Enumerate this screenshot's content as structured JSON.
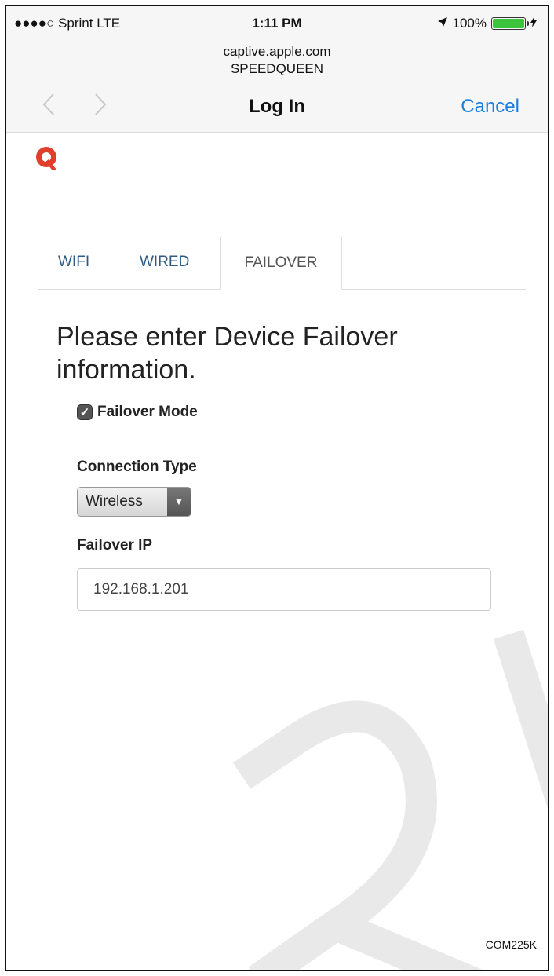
{
  "status_bar": {
    "carrier": "●●●●○ Sprint  LTE",
    "time": "1:11 PM",
    "location_icon": "location-arrow-icon",
    "battery": "100%",
    "battery_level": 1.0,
    "charging_icon": "lightning-icon"
  },
  "browser": {
    "host": "captive.apple.com",
    "network": "SPEEDQUEEN",
    "back_icon": "chevron-left-icon",
    "forward_icon": "chevron-right-icon",
    "title": "Log In",
    "cancel_label": "Cancel"
  },
  "logo": {
    "icon": "speedqueen-logo-icon"
  },
  "tabs": [
    {
      "label": "WIFI",
      "active": false
    },
    {
      "label": "WIRED",
      "active": false
    },
    {
      "label": "FAILOVER",
      "active": true
    }
  ],
  "form": {
    "heading": "Please enter Device Failover information.",
    "failover_mode_label": "Failover Mode",
    "failover_mode_checked": true,
    "connection_type_label": "Connection Type",
    "connection_type_value": "Wireless",
    "failover_ip_label": "Failover IP",
    "failover_ip_value": "192.168.1.201"
  },
  "footer": {
    "code": "COM225K"
  },
  "colors": {
    "accent": "#1a7ee0",
    "tab_link": "#2f5b84",
    "logo": "#e0402a"
  }
}
